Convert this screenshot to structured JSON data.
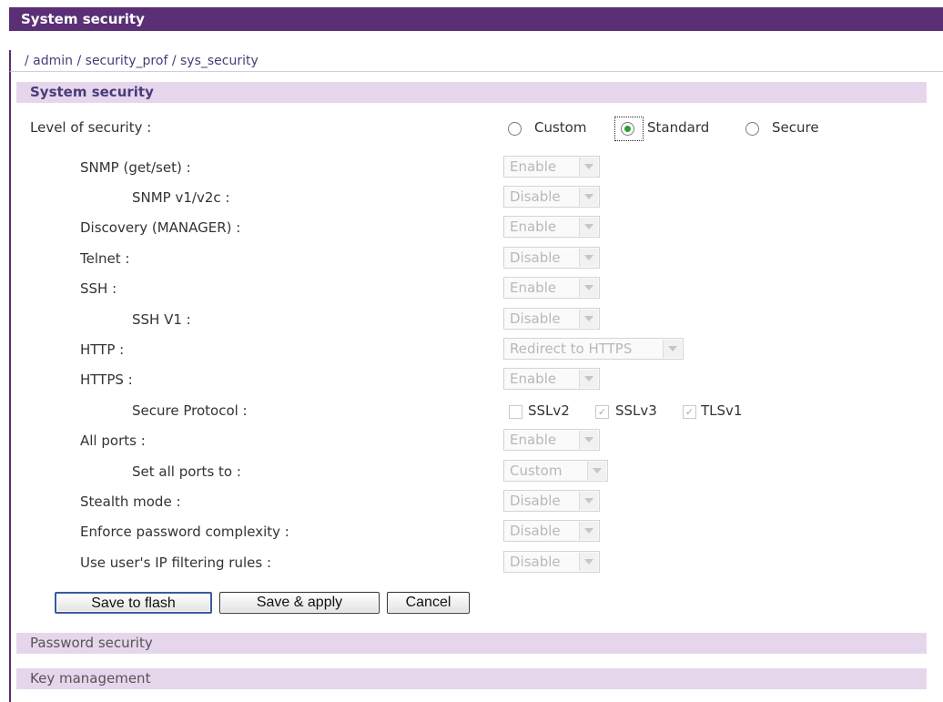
{
  "window": {
    "title": "System security"
  },
  "breadcrumb": "/ admin / security_prof / sys_security",
  "sections": {
    "system_security": "System security",
    "password_security": "Password security",
    "key_management": "Key management"
  },
  "level": {
    "label": "Level of security :",
    "options": [
      "Custom",
      "Standard",
      "Secure"
    ],
    "selected": "Standard"
  },
  "settings": [
    {
      "label": "SNMP (get/set) :",
      "value": "Enable"
    },
    {
      "label": "SNMP v1/v2c :",
      "value": "Disable"
    },
    {
      "label": "Discovery (MANAGER) :",
      "value": "Enable"
    },
    {
      "label": "Telnet :",
      "value": "Disable"
    },
    {
      "label": "SSH :",
      "value": "Enable"
    },
    {
      "label": "SSH V1 :",
      "value": "Disable"
    },
    {
      "label": "HTTP :",
      "value": "Redirect to HTTPS"
    },
    {
      "label": "HTTPS :",
      "value": "Enable"
    },
    {
      "label": "Secure Protocol :",
      "value": ""
    },
    {
      "label": "All ports :",
      "value": "Enable"
    },
    {
      "label": "Set all ports to :",
      "value": "Custom"
    },
    {
      "label": "Stealth mode :",
      "value": "Disable"
    },
    {
      "label": "Enforce password complexity :",
      "value": "Disable"
    },
    {
      "label": "Use user's IP filtering rules :",
      "value": "Disable"
    }
  ],
  "secure_protocol": [
    {
      "label": "SSLv2",
      "checked": false
    },
    {
      "label": "SSLv3",
      "checked": true
    },
    {
      "label": "TLSv1",
      "checked": true
    }
  ],
  "buttons": {
    "save_flash": "Save to flash",
    "save_apply": "Save & apply",
    "cancel": "Cancel"
  },
  "colors": {
    "header": "#5a2f76",
    "section_bg": "#e6d6ec",
    "radio_selected": "#2aa02a"
  }
}
